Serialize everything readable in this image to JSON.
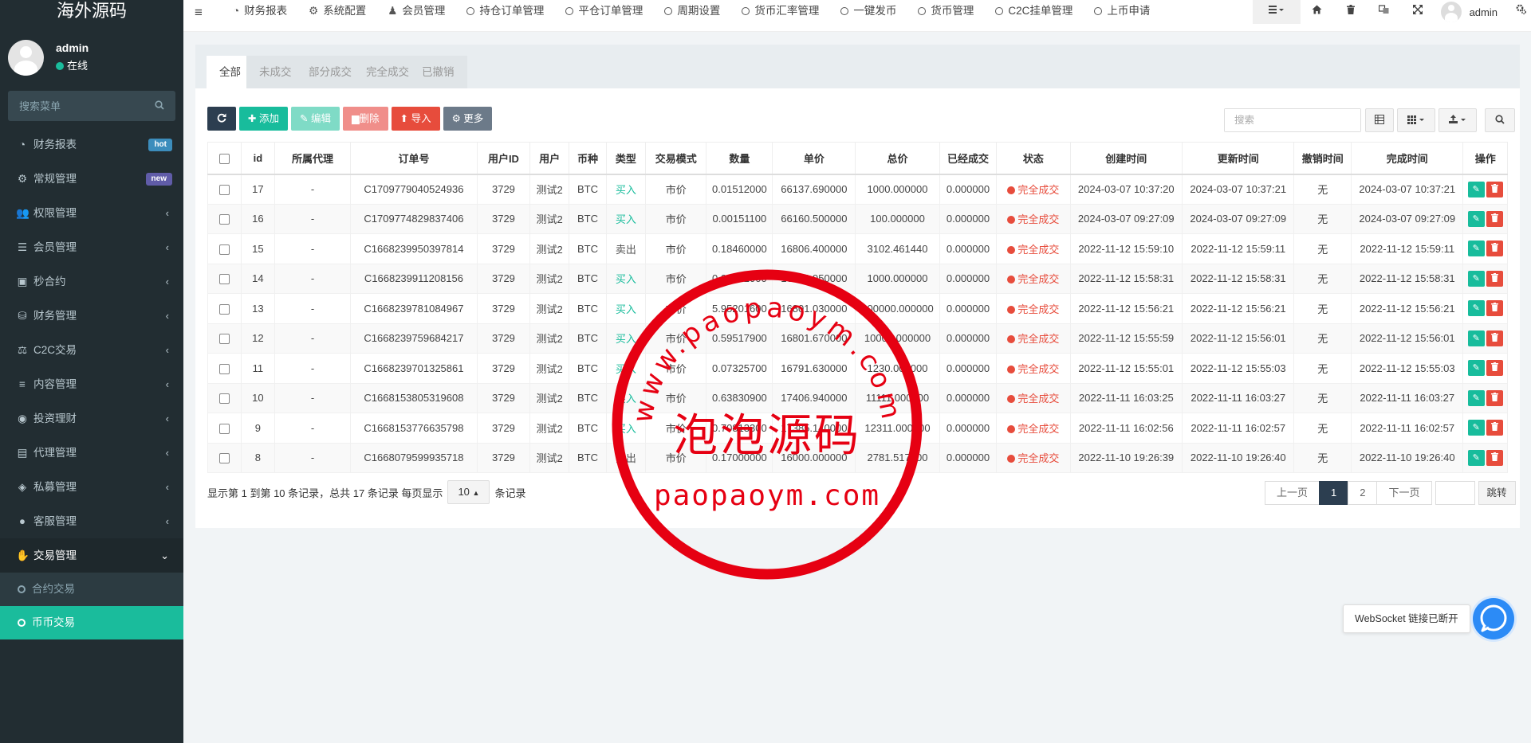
{
  "sidebar": {
    "logo": "海外源码",
    "user": {
      "name": "admin",
      "status": "在线"
    },
    "search_placeholder": "搜索菜单",
    "menu": [
      {
        "label": "财务报表",
        "icon": "dashboard-icon",
        "badge": "hot"
      },
      {
        "label": "常规管理",
        "icon": "cogs-icon",
        "badge": "new"
      },
      {
        "label": "权限管理",
        "icon": "users-icon"
      },
      {
        "label": "会员管理",
        "icon": "list-icon"
      },
      {
        "label": "秒合约",
        "icon": "calendar-icon"
      },
      {
        "label": "财务管理",
        "icon": "database-icon"
      },
      {
        "label": "C2C交易",
        "icon": "balance-icon"
      },
      {
        "label": "内容管理",
        "icon": "align-icon"
      },
      {
        "label": "投资理财",
        "icon": "compass-icon"
      },
      {
        "label": "代理管理",
        "icon": "briefcase-icon"
      },
      {
        "label": "私募管理",
        "icon": "diamond-icon"
      },
      {
        "label": "客服管理",
        "icon": "comment-icon"
      },
      {
        "label": "交易管理",
        "icon": "handshake-icon"
      }
    ],
    "submenu": [
      {
        "label": "合约交易"
      },
      {
        "label": "币币交易"
      }
    ]
  },
  "topnav": {
    "links": [
      {
        "label": "财务报表",
        "icon": "dashboard-icon"
      },
      {
        "label": "系统配置",
        "icon": "gear-icon"
      },
      {
        "label": "会员管理",
        "icon": "user-icon"
      },
      {
        "label": "持仓订单管理",
        "icon": "circle-icon"
      },
      {
        "label": "平仓订单管理",
        "icon": "circle-icon"
      },
      {
        "label": "周期设置",
        "icon": "circle-icon"
      },
      {
        "label": "货币汇率管理",
        "icon": "circle-icon"
      },
      {
        "label": "一键发币",
        "icon": "circle-icon"
      },
      {
        "label": "货币管理",
        "icon": "circle-icon"
      },
      {
        "label": "C2C挂单管理",
        "icon": "circle-icon"
      },
      {
        "label": "上币申请",
        "icon": "circle-icon"
      }
    ],
    "username": "admin"
  },
  "tabs": [
    "全部",
    "未成交",
    "部分成交",
    "完全成交",
    "已撤销"
  ],
  "toolbar": {
    "add": "添加",
    "edit": "编辑",
    "delete": "删除",
    "import": "导入",
    "more": "更多",
    "search_placeholder": "搜索"
  },
  "table": {
    "columns": [
      "id",
      "所属代理",
      "订单号",
      "用户ID",
      "用户",
      "币种",
      "类型",
      "交易模式",
      "数量",
      "单价",
      "总价",
      "已经成交",
      "状态",
      "创建时间",
      "更新时间",
      "撤销时间",
      "完成时间",
      "操作"
    ],
    "rows": [
      {
        "id": "17",
        "agent": "-",
        "order": "C1709779040524936",
        "uid": "3729",
        "user": "测试2",
        "coin": "BTC",
        "type": "买入",
        "mode": "市价",
        "qty": "0.01512000",
        "price": "66137.690000",
        "total": "1000.000000",
        "done": "0.000000",
        "status": "完全成交",
        "created": "2024-03-07 10:37:20",
        "updated": "2024-03-07 10:37:21",
        "cancel": "无",
        "finished": "2024-03-07 10:37:21"
      },
      {
        "id": "16",
        "agent": "-",
        "order": "C1709774829837406",
        "uid": "3729",
        "user": "测试2",
        "coin": "BTC",
        "type": "买入",
        "mode": "市价",
        "qty": "0.00151100",
        "price": "66160.500000",
        "total": "100.000000",
        "done": "0.000000",
        "status": "完全成交",
        "created": "2024-03-07 09:27:09",
        "updated": "2024-03-07 09:27:09",
        "cancel": "无",
        "finished": "2024-03-07 09:27:09"
      },
      {
        "id": "15",
        "agent": "-",
        "order": "C1668239950397814",
        "uid": "3729",
        "user": "测试2",
        "coin": "BTC",
        "type": "卖出",
        "mode": "市价",
        "qty": "0.18460000",
        "price": "16806.400000",
        "total": "3102.461440",
        "done": "0.000000",
        "status": "完全成交",
        "created": "2022-11-12 15:59:10",
        "updated": "2022-11-12 15:59:11",
        "cancel": "无",
        "finished": "2022-11-12 15:59:11"
      },
      {
        "id": "14",
        "agent": "-",
        "order": "C1668239911208156",
        "uid": "3729",
        "user": "测试2",
        "coin": "BTC",
        "type": "买入",
        "mode": "市价",
        "qty": "0.05952000",
        "price": "16800.950000",
        "total": "1000.000000",
        "done": "0.000000",
        "status": "完全成交",
        "created": "2022-11-12 15:58:31",
        "updated": "2022-11-12 15:58:31",
        "cancel": "无",
        "finished": "2022-11-12 15:58:31"
      },
      {
        "id": "13",
        "agent": "-",
        "order": "C1668239781084967",
        "uid": "3729",
        "user": "测试2",
        "coin": "BTC",
        "type": "买入",
        "mode": "市价",
        "qty": "5.95201600",
        "price": "16801.030000",
        "total": "100000.000000",
        "done": "0.000000",
        "status": "完全成交",
        "created": "2022-11-12 15:56:21",
        "updated": "2022-11-12 15:56:21",
        "cancel": "无",
        "finished": "2022-11-12 15:56:21"
      },
      {
        "id": "12",
        "agent": "-",
        "order": "C1668239759684217",
        "uid": "3729",
        "user": "测试2",
        "coin": "BTC",
        "type": "买入",
        "mode": "市价",
        "qty": "0.59517900",
        "price": "16801.670000",
        "total": "10000.000000",
        "done": "0.000000",
        "status": "完全成交",
        "created": "2022-11-12 15:55:59",
        "updated": "2022-11-12 15:56:01",
        "cancel": "无",
        "finished": "2022-11-12 15:56:01"
      },
      {
        "id": "11",
        "agent": "-",
        "order": "C1668239701325861",
        "uid": "3729",
        "user": "测试2",
        "coin": "BTC",
        "type": "买入",
        "mode": "市价",
        "qty": "0.07325700",
        "price": "16791.630000",
        "total": "1230.000000",
        "done": "0.000000",
        "status": "完全成交",
        "created": "2022-11-12 15:55:01",
        "updated": "2022-11-12 15:55:03",
        "cancel": "无",
        "finished": "2022-11-12 15:55:03"
      },
      {
        "id": "10",
        "agent": "-",
        "order": "C1668153805319608",
        "uid": "3729",
        "user": "测试2",
        "coin": "BTC",
        "type": "买入",
        "mode": "市价",
        "qty": "0.63830900",
        "price": "17406.940000",
        "total": "11111.000000",
        "done": "0.000000",
        "status": "完全成交",
        "created": "2022-11-11 16:03:25",
        "updated": "2022-11-11 16:03:27",
        "cancel": "无",
        "finished": "2022-11-11 16:03:27"
      },
      {
        "id": "9",
        "agent": "-",
        "order": "C1668153776635798",
        "uid": "3729",
        "user": "测试2",
        "coin": "BTC",
        "type": "买入",
        "mode": "市价",
        "qty": "0.70813300",
        "price": "17385.140000",
        "total": "12311.000000",
        "done": "0.000000",
        "status": "完全成交",
        "created": "2022-11-11 16:02:56",
        "updated": "2022-11-11 16:02:57",
        "cancel": "无",
        "finished": "2022-11-11 16:02:57"
      },
      {
        "id": "8",
        "agent": "-",
        "order": "C1668079599935718",
        "uid": "3729",
        "user": "测试2",
        "coin": "BTC",
        "type": "卖出",
        "mode": "市价",
        "qty": "0.17000000",
        "price": "16000.000000",
        "total": "2781.517900",
        "done": "0.000000",
        "status": "完全成交",
        "created": "2022-11-10 19:26:39",
        "updated": "2022-11-10 19:26:40",
        "cancel": "无",
        "finished": "2022-11-10 19:26:40"
      }
    ]
  },
  "pagination": {
    "info_prefix": "显示第 1 到第 10 条记录，总共 17 条记录 每页显示",
    "page_size": "10",
    "info_suffix": "条记录",
    "prev": "上一页",
    "pages": [
      "1",
      "2"
    ],
    "current": "1",
    "next": "下一页",
    "jump": "跳转"
  },
  "watermark": {
    "url_text": "www.paopaoym.com",
    "cn_text": "泡泡源码",
    "bottom_text": "paopaoym.com",
    "color": "#e60012"
  },
  "toast": {
    "text": "WebSocket 链接已断开"
  },
  "colors": {
    "sidebar": "#222d32",
    "accent": "#18bc9c",
    "danger": "#e74c3c",
    "dark": "#2c3e50"
  }
}
